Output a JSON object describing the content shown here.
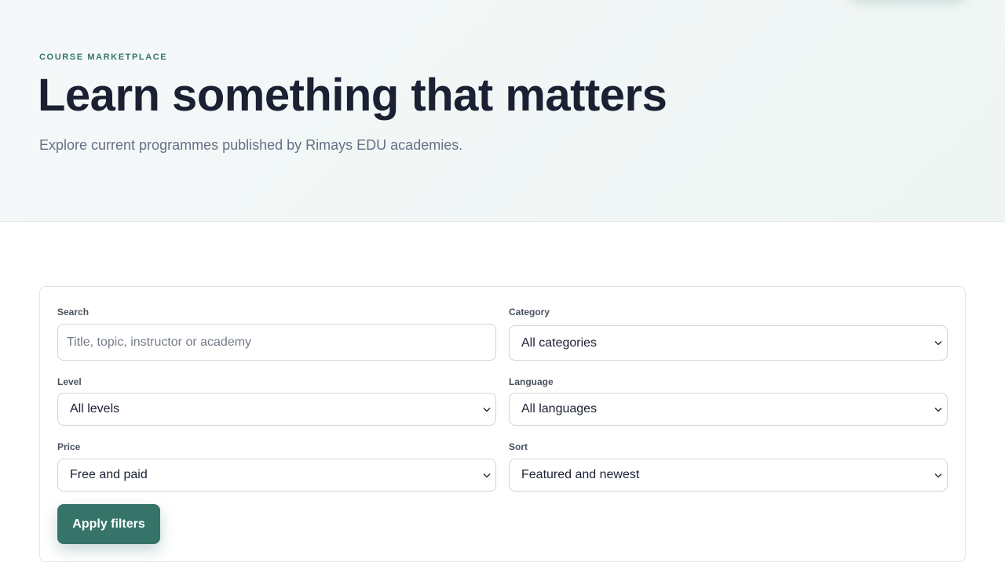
{
  "hero": {
    "eyebrow": "COURSE MARKETPLACE",
    "title": "Learn something that matters",
    "subtitle": "Explore current programmes published by Rimays EDU academies."
  },
  "filters": {
    "search": {
      "label": "Search",
      "value": "",
      "placeholder": "Title, topic, instructor or academy"
    },
    "category": {
      "label": "Category",
      "selected": "All categories"
    },
    "level": {
      "label": "Level",
      "selected": "All levels"
    },
    "language": {
      "label": "Language",
      "selected": "All languages"
    },
    "price": {
      "label": "Price",
      "selected": "Free and paid"
    },
    "sort": {
      "label": "Sort",
      "selected": "Featured and newest"
    },
    "apply_label": "Apply filters"
  },
  "colors": {
    "accent": "#36746a",
    "heading": "#1b2033",
    "muted": "#667085"
  },
  "icons": [
    "chevron-down-icon"
  ]
}
